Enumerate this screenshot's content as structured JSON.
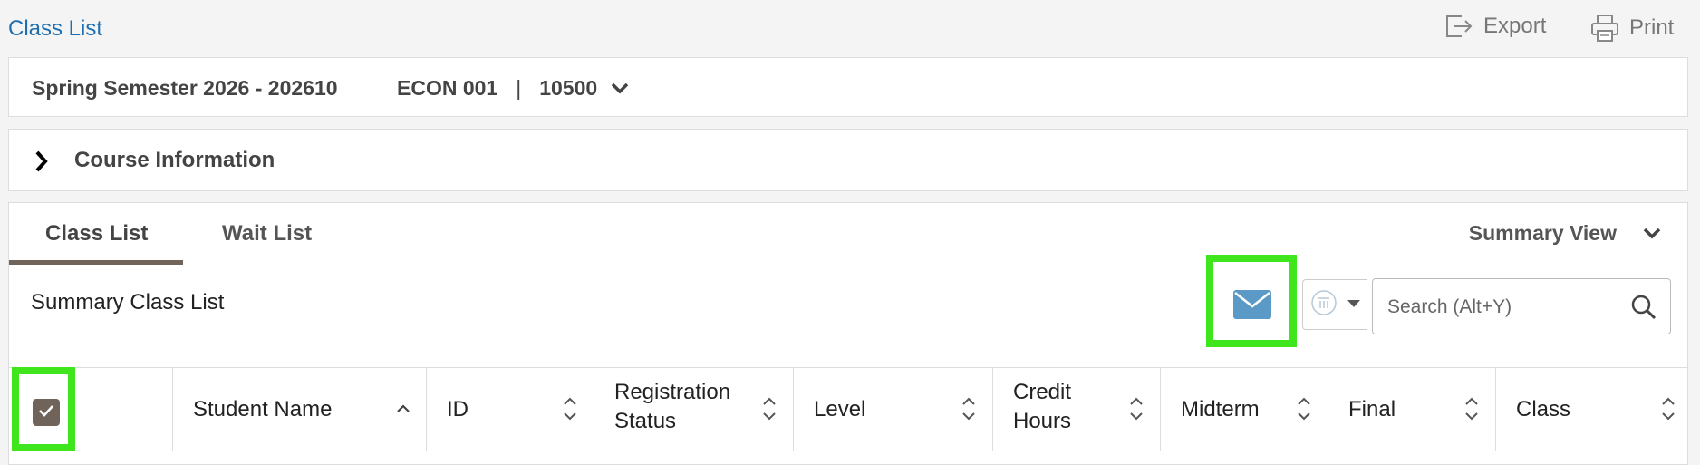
{
  "header": {
    "breadcrumb": "Class List",
    "export_label": "Export",
    "print_label": "Print"
  },
  "term": {
    "label": "Spring Semester 2026 - 202610",
    "course_code": "ECON 001",
    "crn": "10500"
  },
  "course_info": {
    "label": "Course Information"
  },
  "tabs": [
    {
      "label": "Class List",
      "active": true
    },
    {
      "label": "Wait List",
      "active": false
    }
  ],
  "view_selector": {
    "label": "Summary View"
  },
  "section": {
    "title": "Summary Class List"
  },
  "search": {
    "placeholder": "Search (Alt+Y)",
    "value": ""
  },
  "columns": [
    {
      "line1": "Student Name",
      "line2": ""
    },
    {
      "line1": "ID",
      "line2": ""
    },
    {
      "line1": "Registration",
      "line2": "Status"
    },
    {
      "line1": "Level",
      "line2": ""
    },
    {
      "line1": "Credit",
      "line2": "Hours"
    },
    {
      "line1": "Midterm",
      "line2": ""
    },
    {
      "line1": "Final",
      "line2": ""
    },
    {
      "line1": "Class",
      "line2": ""
    }
  ],
  "select_all_checked": true,
  "colors": {
    "link": "#1f6fb0",
    "accent": "#6f635a",
    "highlight": "#3fe61d",
    "email": "#5b9ac6"
  }
}
